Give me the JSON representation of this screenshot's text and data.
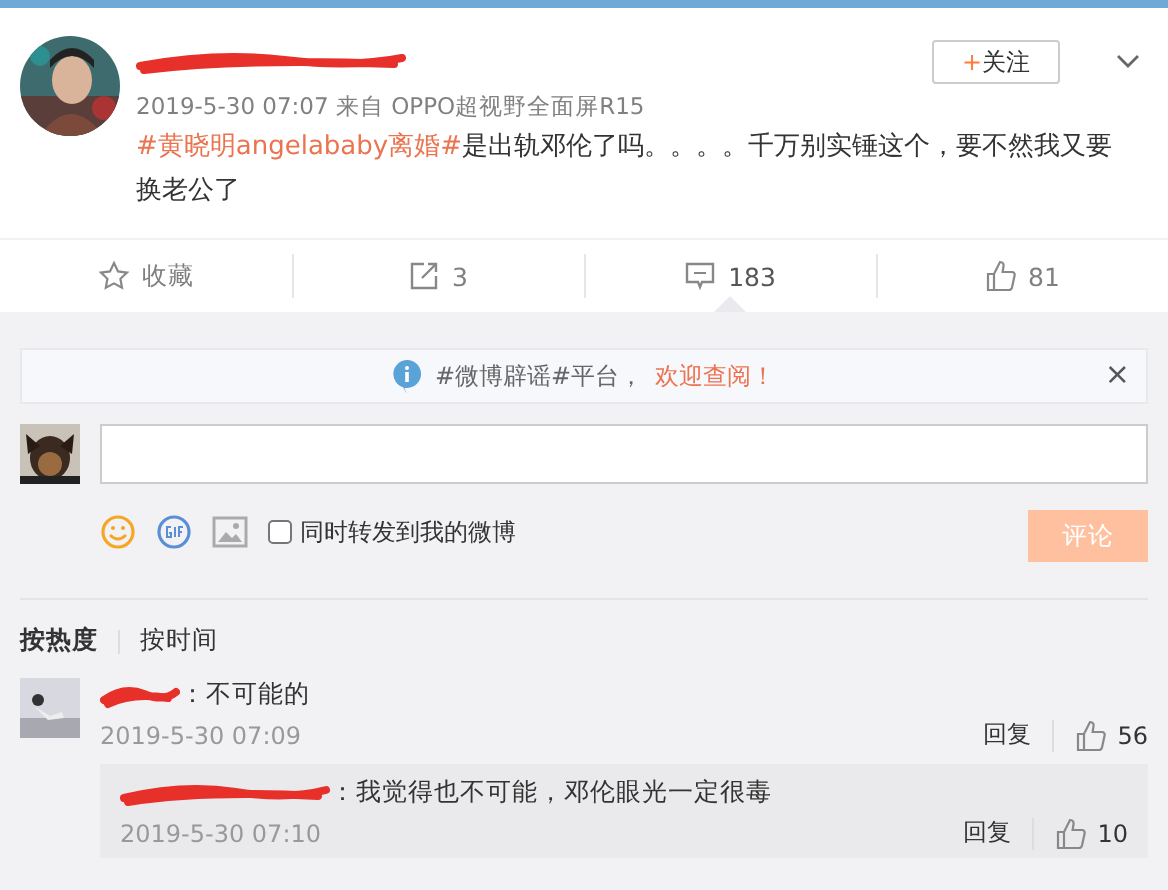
{
  "post": {
    "follow_label": "+关注",
    "time": "2019-5-30 07:07",
    "source_prefix": "来自",
    "source": "OPPO超视野全面屏R15",
    "topic": "#黄晓明angelababy离婚#",
    "text": "是出轨邓伦了吗。。。。千万别实锤这个，要不然我又要换老公了"
  },
  "actions": [
    {
      "kind": "favorite",
      "label": "收藏",
      "selected": false
    },
    {
      "kind": "repost",
      "label": "3",
      "selected": false
    },
    {
      "kind": "comment",
      "label": "183",
      "selected": true
    },
    {
      "kind": "like",
      "label": "81",
      "selected": false
    }
  ],
  "notice": {
    "text": "#微博辟谣#平台，",
    "link": "欢迎查阅！",
    "close": "×"
  },
  "composer": {
    "repost_label": "同时转发到我的微博",
    "repost_checked": false,
    "submit": "评论",
    "submit_disabled": true
  },
  "sort_tabs": [
    {
      "label": "按热度",
      "selected": true
    },
    {
      "label": "按时间",
      "selected": false
    }
  ],
  "comments": [
    {
      "text": "：不可能的",
      "time": "2019-5-30 07:09",
      "reply": "回复",
      "likes": "56",
      "replies": [
        {
          "text": "：我觉得也不可能，邓伦眼光一定很毒",
          "time": "2019-5-30 07:10",
          "reply": "回复",
          "likes": "10"
        }
      ]
    }
  ]
}
